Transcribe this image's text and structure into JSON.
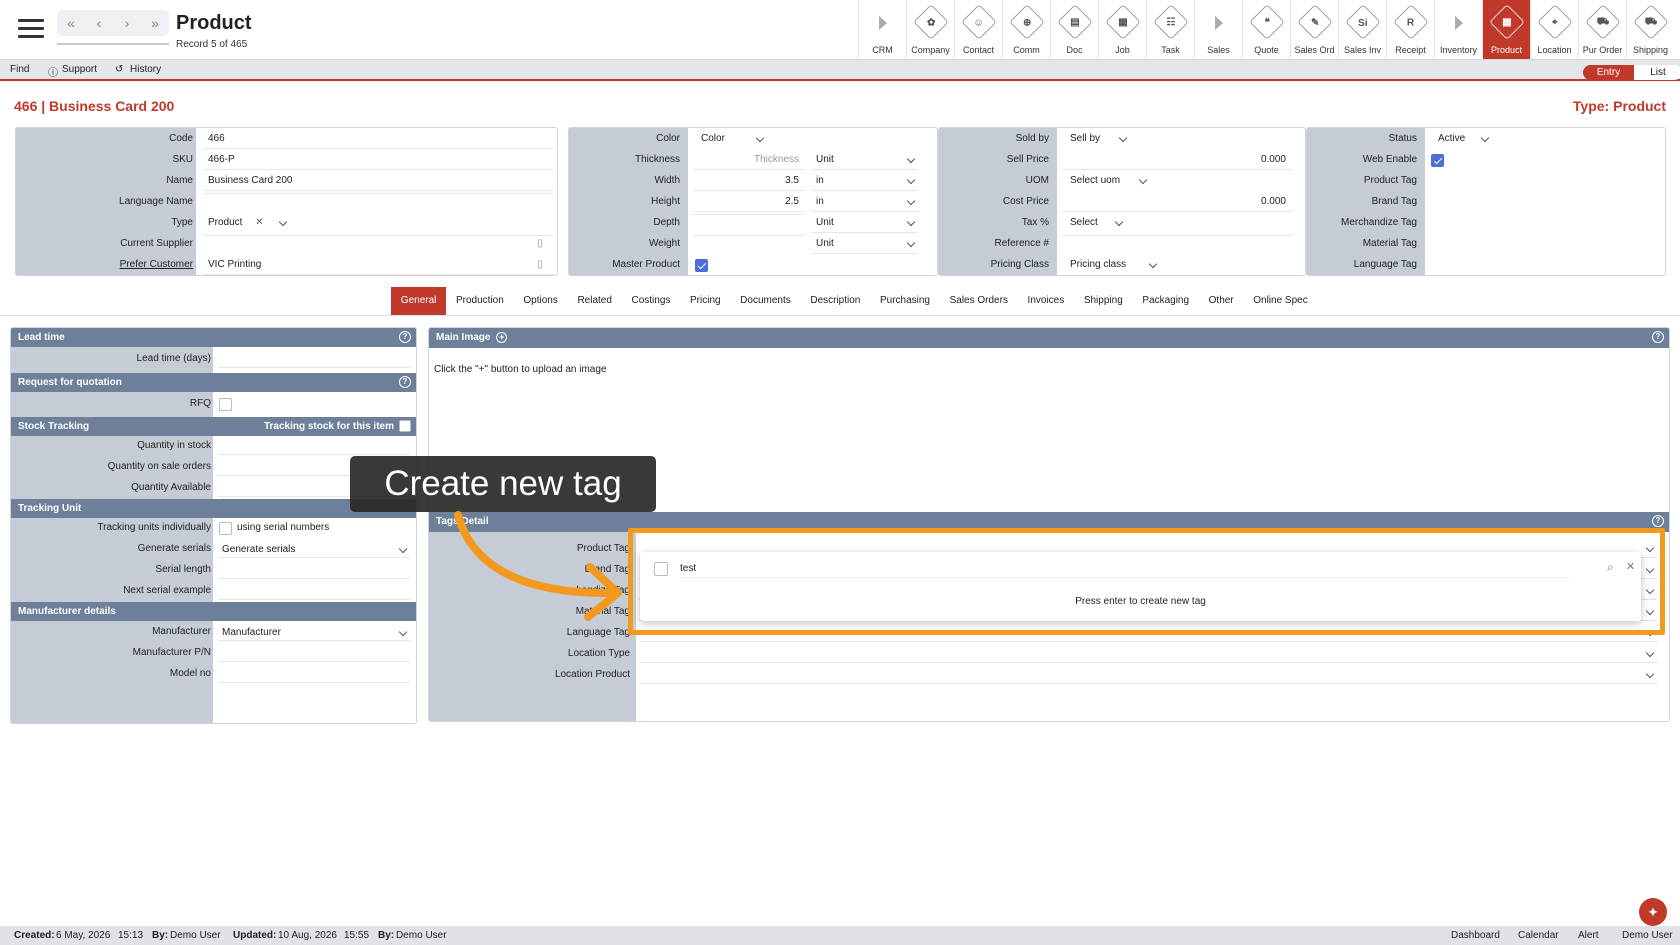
{
  "header": {
    "title": "Product",
    "record_info": "Record 5 of 465",
    "nav": [
      "«",
      "‹",
      "›",
      "»"
    ]
  },
  "modules": [
    {
      "label": "CRM",
      "icon": "arrow-right-icon",
      "glyph": ""
    },
    {
      "label": "Company",
      "icon": "company-icon",
      "glyph": "✿"
    },
    {
      "label": "Contact",
      "icon": "contact-icon",
      "glyph": "☺"
    },
    {
      "label": "Comm",
      "icon": "globe-icon",
      "glyph": "⊕"
    },
    {
      "label": "Doc",
      "icon": "document-icon",
      "glyph": "▤"
    },
    {
      "label": "Job",
      "icon": "job-icon",
      "glyph": "▦"
    },
    {
      "label": "Task",
      "icon": "task-icon",
      "glyph": "☷"
    },
    {
      "label": "Sales",
      "icon": "arrow-right-icon",
      "glyph": ""
    },
    {
      "label": "Quote",
      "icon": "quote-icon",
      "glyph": "❝"
    },
    {
      "label": "Sales Ord",
      "icon": "sales-order-icon",
      "glyph": "✎"
    },
    {
      "label": "Sales Inv",
      "icon": "sales-invoice-icon",
      "glyph": "Si"
    },
    {
      "label": "Receipt",
      "icon": "receipt-icon",
      "glyph": "R"
    },
    {
      "label": "Inventory",
      "icon": "arrow-right-icon",
      "glyph": ""
    },
    {
      "label": "Product",
      "icon": "product-icon",
      "glyph": "▦"
    },
    {
      "label": "Location",
      "icon": "location-icon",
      "glyph": "⌖"
    },
    {
      "label": "Pur Order",
      "icon": "cart-icon",
      "glyph": "⛟"
    },
    {
      "label": "Shipping",
      "icon": "truck-icon",
      "glyph": "⛟"
    }
  ],
  "toolbar": {
    "find": "Find",
    "support": "Support",
    "history": "History",
    "entry": "Entry",
    "list": "List"
  },
  "record": {
    "title": "466 | Business Card 200",
    "type": "Type: Product"
  },
  "panel1": {
    "labels": [
      "Code",
      "SKU",
      "Name",
      "Language Name",
      "Type",
      "Current Supplier",
      "Prefer Customer"
    ],
    "code": "466",
    "sku": "466-P",
    "name": "Business Card 200",
    "language_name": "",
    "type": "Product",
    "current_supplier": "",
    "prefer_customer": "VIC Printing"
  },
  "panel2": {
    "labels": [
      "Color",
      "Thickness",
      "Width",
      "Height",
      "Depth",
      "Weight",
      "Master Product"
    ],
    "color": "Color",
    "thickness_placeholder": "Thickness",
    "thickness_unit": "Unit",
    "width": "3.5",
    "width_unit": "in",
    "height": "2.5",
    "height_unit": "in",
    "depth_unit": "Unit",
    "weight_unit": "Unit",
    "master_product": true
  },
  "panel3": {
    "labels": [
      "Sold by",
      "Sell Price",
      "UOM",
      "Cost Price",
      "Tax %",
      "Reference #",
      "Pricing Class"
    ],
    "sold_by": "Sell by",
    "sell_price": "0.000",
    "uom": "Select uom",
    "cost_price": "0.000",
    "tax": "Select",
    "reference": "",
    "pricing_class": "Pricing class"
  },
  "panel4": {
    "labels": [
      "Status",
      "Web Enable",
      "Product Tag",
      "Brand Tag",
      "Merchandize Tag",
      "Material Tag",
      "Language Tag"
    ],
    "status": "Active",
    "web_enable": true
  },
  "tabs": [
    "General",
    "Production",
    "Options",
    "Related",
    "Costings",
    "Pricing",
    "Documents",
    "Description",
    "Purchasing",
    "Sales Orders",
    "Invoices",
    "Shipping",
    "Packaging",
    "Other",
    "Online Spec"
  ],
  "left_panel": {
    "lead_time_header": "Lead time",
    "lead_time_label": "Lead time (days)",
    "rfq_header": "Request for quotation",
    "rfq_label": "RFQ",
    "stock_header": "Stock Tracking",
    "stock_track_label": "Tracking stock for this item",
    "stock_labels": [
      "Quantity in stock",
      "Quantity on sale orders",
      "Quantity Available"
    ],
    "unit_header": "Tracking Unit",
    "unit_track_label": "Tracking units individually",
    "unit_track_text": "using serial numbers",
    "gen_serials_label": "Generate serials",
    "gen_serials_value": "Generate serials",
    "serial_len_label": "Serial length",
    "next_serial_label": "Next serial example",
    "mfr_header": "Manufacturer details",
    "mfr_label": "Manufacturer",
    "mfr_value": "Manufacturer",
    "mfr_pn_label": "Manufacturer P/N",
    "model_label": "Model no"
  },
  "main_image": {
    "header": "Main Image",
    "hint": "Click the \"+\" button to upload an image"
  },
  "tags_detail": {
    "header": "Tags Detail",
    "labels": [
      "Product Tag",
      "Brand Tag",
      "Merchandize Tag",
      "Material Tag",
      "Language Tag",
      "Location Type",
      "Location Product"
    ]
  },
  "tag_dropdown": {
    "search_value": "test",
    "message": "Press enter to create new tag"
  },
  "callout": "Create new tag",
  "footer": {
    "created_label": "Created:",
    "created": "6 May, 2026",
    "created_time": "15:13",
    "by_label": "By:",
    "created_by": "Demo User",
    "updated_label": "Updated:",
    "updated": "10 Aug, 2026",
    "updated_time": "15:55",
    "updated_by": "Demo User",
    "links": [
      "Dashboard",
      "Calendar",
      "Alert",
      "Demo User"
    ]
  },
  "colors": {
    "accent": "#c0392b",
    "section_header": "#6e7f99",
    "label_bg": "#c5ccd6",
    "highlight": "#f39a1e"
  }
}
